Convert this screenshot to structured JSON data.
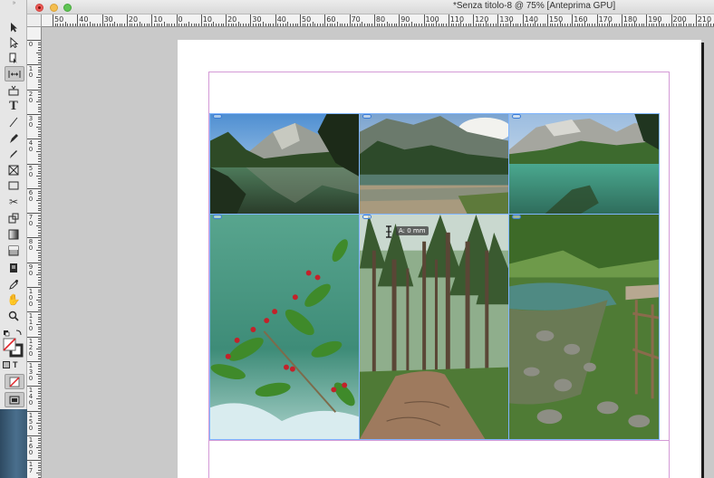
{
  "window": {
    "title": "*Senza titolo-8 @ 75% [Anteprima GPU]"
  },
  "toolbar": {
    "tools": [
      {
        "name": "selection-tool-icon"
      },
      {
        "name": "direct-selection-tool-icon"
      },
      {
        "name": "page-tool-icon"
      },
      {
        "name": "gap-tool-icon",
        "active": true
      },
      {
        "name": "content-collector-icon"
      },
      {
        "name": "type-tool-icon",
        "glyph": "T"
      },
      {
        "name": "line-tool-icon"
      },
      {
        "name": "pen-tool-icon"
      },
      {
        "name": "pencil-tool-icon"
      },
      {
        "name": "rectangle-frame-tool-icon"
      },
      {
        "name": "rectangle-tool-icon"
      },
      {
        "name": "scissors-tool-icon"
      },
      {
        "name": "free-transform-tool-icon"
      },
      {
        "name": "gradient-swatch-tool-icon"
      },
      {
        "name": "gradient-feather-tool-icon"
      },
      {
        "name": "note-tool-icon"
      },
      {
        "name": "eyedropper-tool-icon"
      },
      {
        "name": "hand-tool-icon"
      },
      {
        "name": "zoom-tool-icon"
      }
    ],
    "format_labels": {
      "text_mode": "T"
    }
  },
  "rulers": {
    "horizontal_labels": [
      "50",
      "40",
      "30",
      "20",
      "10",
      "0",
      "10",
      "20",
      "30",
      "40",
      "50",
      "60",
      "70",
      "80",
      "90",
      "100",
      "110",
      "120",
      "130",
      "140",
      "150",
      "160",
      "170",
      "180",
      "190",
      "200",
      "210"
    ],
    "vertical_labels": [
      "0",
      "1 0",
      "2 0",
      "3 0",
      "4 0",
      "5 0",
      "6 0",
      "7 0",
      "8 0",
      "9 0",
      "1 0 0",
      "1 1 0",
      "1 2 0",
      "1 3 0",
      "1 4 0",
      "1 5 0",
      "1 6 0",
      "1 7"
    ]
  },
  "canvas": {
    "tooltip": "A: 0 mm",
    "photos": [
      {
        "name": "photo-lake-mountains-1",
        "scene": "lake"
      },
      {
        "name": "photo-lake-forest-2",
        "scene": "lake-forest"
      },
      {
        "name": "photo-lake-mountains-3",
        "scene": "lake-green"
      },
      {
        "name": "photo-berries-branch",
        "scene": "berries"
      },
      {
        "name": "photo-forest-path",
        "scene": "forest"
      },
      {
        "name": "photo-stream-rocks",
        "scene": "stream"
      }
    ]
  },
  "colors": {
    "guide": "#d49ad6",
    "frame_selection": "#7fb5ff",
    "link_badge": "#3b7cd6"
  }
}
